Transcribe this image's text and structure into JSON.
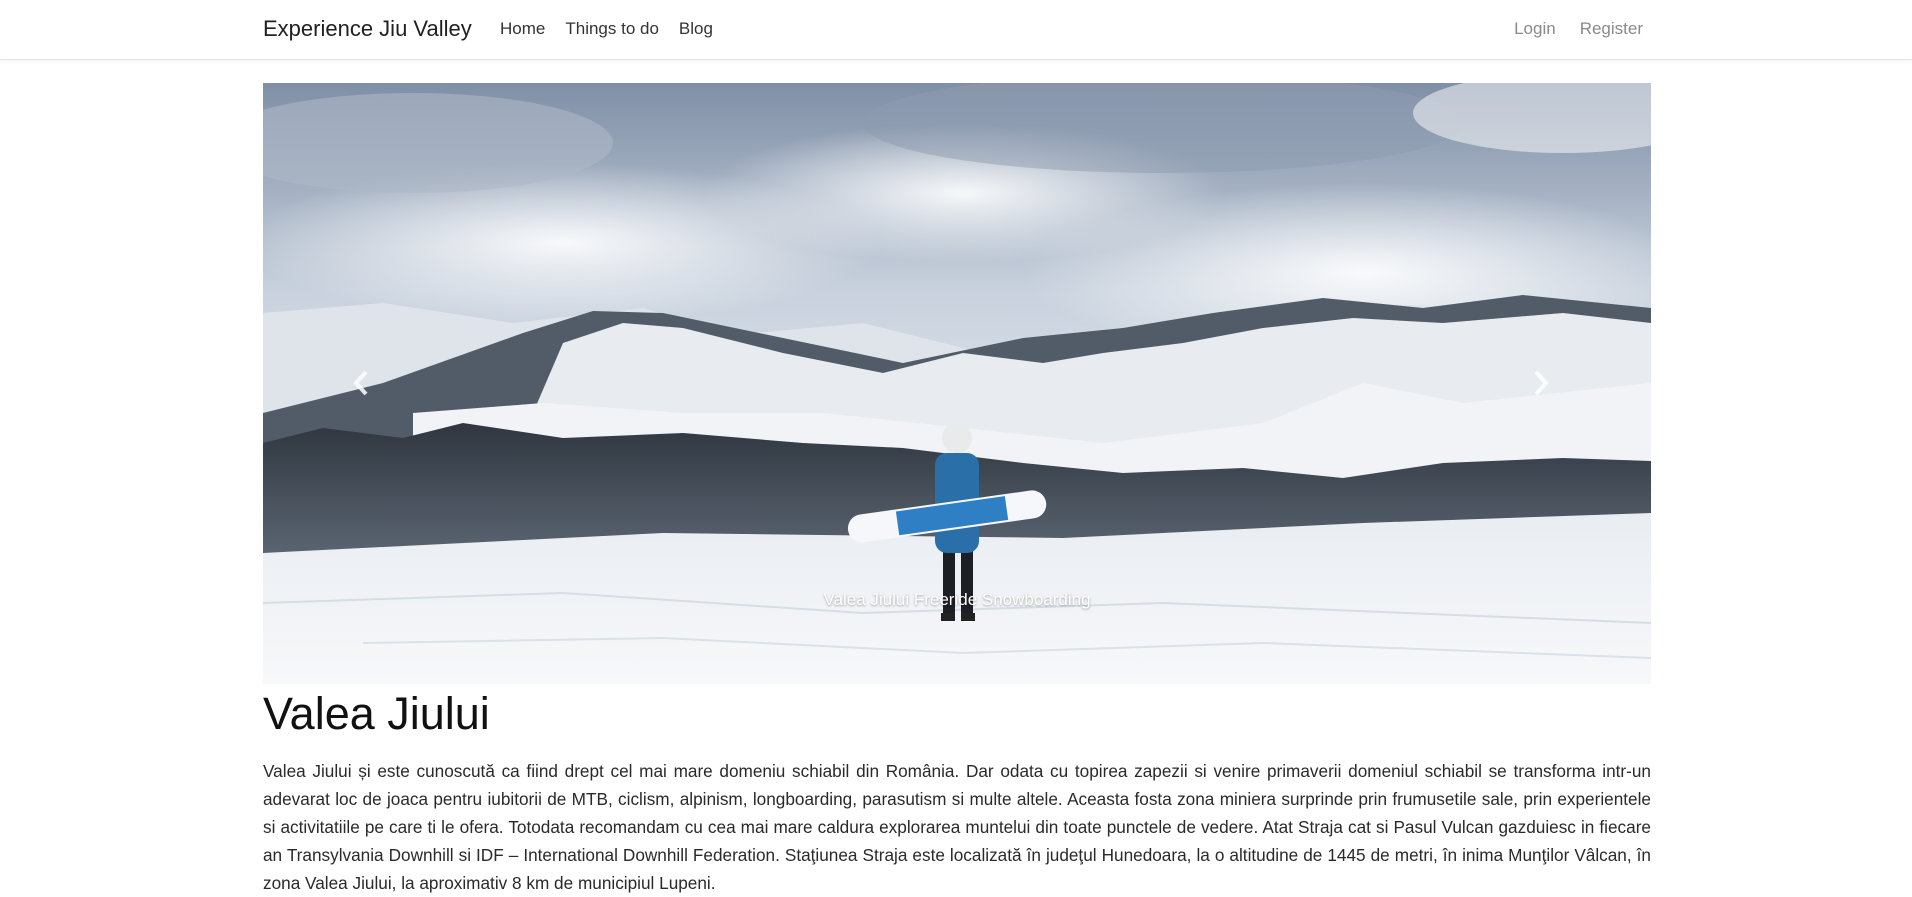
{
  "navbar": {
    "brand": "Experience Jiu Valley",
    "links": [
      "Home",
      "Things to do",
      "Blog"
    ],
    "auth": {
      "login": "Login",
      "register": "Register"
    }
  },
  "carousel": {
    "caption": "Valea Jiului Freeride Snowboarding",
    "prev_icon": "chevron-left-icon",
    "next_icon": "chevron-right-icon"
  },
  "article": {
    "title": "Valea Jiului",
    "body": "Valea Jiului și este cunoscută ca fiind drept cel mai mare domeniu schiabil din România. Dar odata cu topirea zapezii si venire primaverii domeniul schiabil se transforma intr-un adevarat loc de joaca pentru iubitorii de MTB, ciclism, alpinism, longboarding, parasutism si multe altele. Aceasta fosta zona miniera surprinde prin frumusetile sale, prin experientele si activitatiile pe care ti le ofera. Totodata recomandam cu cea mai mare caldura explorarea muntelui din toate punctele de vedere. Atat Straja cat si Pasul Vulcan gazduiesc in fiecare an Transylvania Downhill si IDF – International Downhill Federation. Staţiunea Straja este localizată în judeţul Hunedoara, la o altitudine de 1445 de metri, în inima Munţilor Vâlcan, în zona Valea Jiului, la aproximativ 8 km de municipiul Lupeni."
  }
}
